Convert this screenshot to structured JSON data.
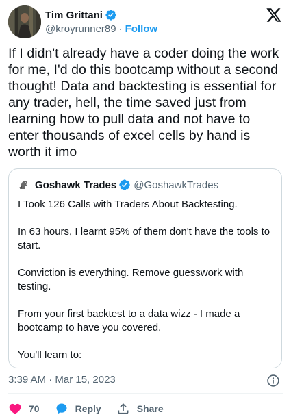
{
  "author": {
    "name": "Tim Grittani",
    "handle": "@kroyrunner89",
    "separator": "·",
    "follow_label": "Follow",
    "verified_color": "#1d9bf0"
  },
  "tweet": {
    "text": "If I didn't already have a coder doing the work for me, I'd do this bootcamp without a second thought! Data and backtesting is essential for any trader, hell, the time saved just from learning how to pull data and not have to enter thousands of excel cells by hand is worth it imo"
  },
  "quote": {
    "name": "Goshawk Trades",
    "handle": "@GoshawkTrades",
    "paragraphs": [
      "I Took 126 Calls with Traders About Backtesting.",
      "In 63 hours, I learnt 95% of them don't have the tools to start.",
      "Conviction is everything. Remove guesswork with testing.",
      "From your first backtest to a data wizz - I made a bootcamp to have you covered.",
      "You'll learn to:"
    ]
  },
  "meta": {
    "timestamp": "3:39 AM · Mar 15, 2023"
  },
  "actions": {
    "like_count": "70",
    "reply_label": "Reply",
    "share_label": "Share",
    "like_color": "#f91880",
    "reply_color": "#1d9bf0"
  },
  "icons": {
    "brand": "x-logo-icon",
    "verified": "verified-badge-icon",
    "info": "info-icon",
    "like": "heart-icon",
    "reply": "speech-bubble-icon",
    "share": "share-upload-icon"
  }
}
